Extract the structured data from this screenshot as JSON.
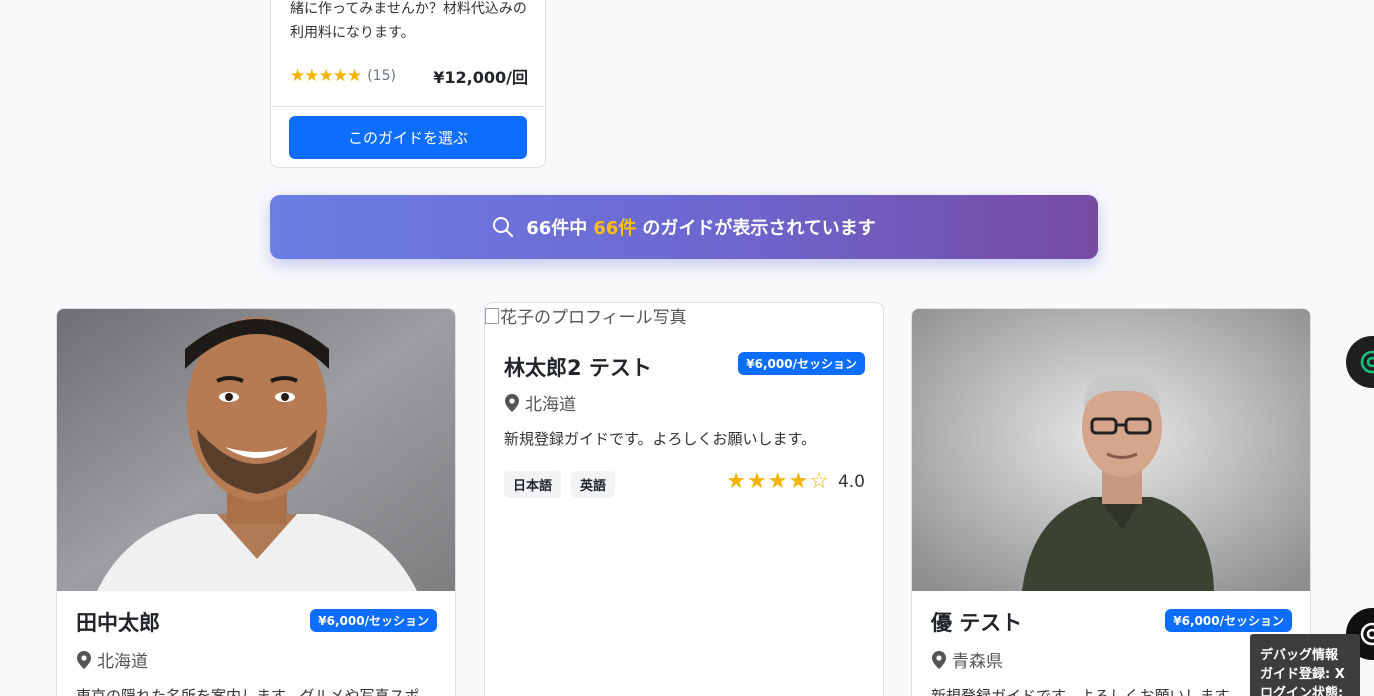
{
  "top_card": {
    "description_line1": "緒に作ってみませんか？材料代込みの",
    "description_line2": "利用料になります。",
    "stars": "★★★★★",
    "review_count": "(15)",
    "price": "¥12,000/回",
    "select_button": "このガイドを選ぶ"
  },
  "results_banner": {
    "total": "66件中",
    "shown": "66件",
    "suffix": "のガイドが表示されています",
    "icon": "search-icon"
  },
  "guides": [
    {
      "name": "田中太郎",
      "price": "¥6,000/セッション",
      "location": "北海道",
      "description": "東京の隠れた名所を案内します。グルメや写真スポ"
    },
    {
      "image_alt": "花子のプロフィール写真",
      "name": "林太郎2 テスト",
      "price": "¥6,000/セッション",
      "location": "北海道",
      "description": "新規登録ガイドです。よろしくお願いします。",
      "languages": [
        "日本語",
        "英語"
      ],
      "rating": 4.0,
      "rating_label": "4.0"
    },
    {
      "name": "優 テスト",
      "price": "¥6,000/セッション",
      "location": "青森県",
      "description": "新規登録ガイドです。よろしくお願いします。"
    }
  ],
  "debug": {
    "title": "デバッグ情報",
    "line1": "ガイド登録: X",
    "line2": "ログイン状態: /"
  },
  "colors": {
    "primary": "#0d6efd",
    "star": "#f5b301",
    "banner_start": "#6b7ee3",
    "banner_end": "#764ba2",
    "highlight": "#ffc107"
  }
}
